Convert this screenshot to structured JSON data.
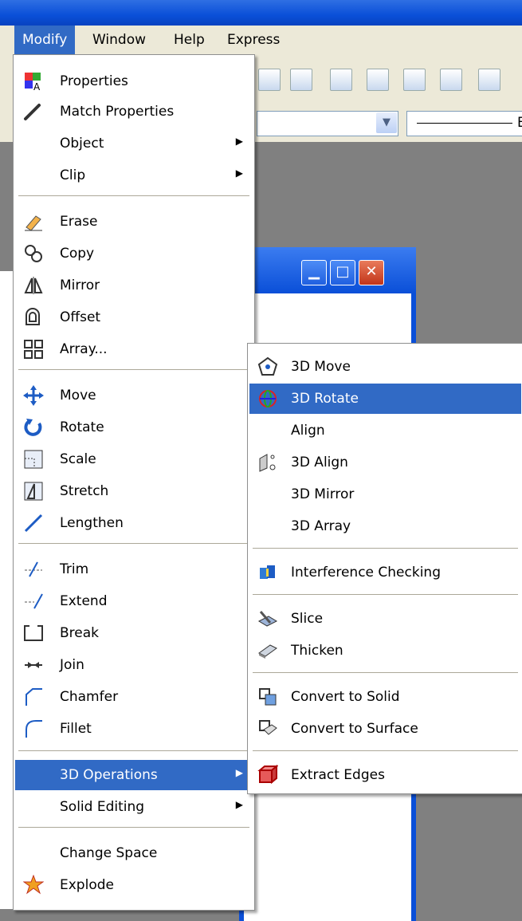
{
  "menubar": {
    "items": [
      "Modify",
      "Window",
      "Help",
      "Express"
    ]
  },
  "modify_menu": {
    "items": [
      {
        "label": "Properties",
        "icon": "properties-icon"
      },
      {
        "label": "Match Properties",
        "icon": "paintbrush-icon"
      },
      {
        "label": "Object",
        "submenu": true
      },
      {
        "label": "Clip",
        "submenu": true
      },
      {
        "label": "Erase",
        "icon": "eraser-icon"
      },
      {
        "label": "Copy",
        "icon": "copy-icon"
      },
      {
        "label": "Mirror",
        "icon": "mirror-icon"
      },
      {
        "label": "Offset",
        "icon": "offset-icon"
      },
      {
        "label": "Array...",
        "icon": "array-icon"
      },
      {
        "label": "Move",
        "icon": "move-icon"
      },
      {
        "label": "Rotate",
        "icon": "rotate-icon"
      },
      {
        "label": "Scale",
        "icon": "scale-icon"
      },
      {
        "label": "Stretch",
        "icon": "stretch-icon"
      },
      {
        "label": "Lengthen",
        "icon": "lengthen-icon"
      },
      {
        "label": "Trim",
        "icon": "trim-icon"
      },
      {
        "label": "Extend",
        "icon": "extend-icon"
      },
      {
        "label": "Break",
        "icon": "break-icon"
      },
      {
        "label": "Join",
        "icon": "join-icon"
      },
      {
        "label": "Chamfer",
        "icon": "chamfer-icon"
      },
      {
        "label": "Fillet",
        "icon": "fillet-icon"
      },
      {
        "label": "3D Operations",
        "submenu": true,
        "selected": true
      },
      {
        "label": "Solid Editing",
        "submenu": true
      },
      {
        "label": "Change Space"
      },
      {
        "label": "Explode",
        "icon": "explode-icon"
      }
    ]
  },
  "ops_menu": {
    "items": [
      {
        "label": "3D Move",
        "icon": "3d-move-icon"
      },
      {
        "label": "3D Rotate",
        "icon": "3d-rotate-icon",
        "selected": true
      },
      {
        "label": "Align"
      },
      {
        "label": "3D Align",
        "icon": "3d-align-icon"
      },
      {
        "label": "3D Mirror"
      },
      {
        "label": "3D Array"
      },
      {
        "label": "Interference Checking",
        "icon": "interference-icon"
      },
      {
        "label": "Slice",
        "icon": "slice-icon"
      },
      {
        "label": "Thicken",
        "icon": "thicken-icon"
      },
      {
        "label": "Convert to Solid",
        "icon": "convert-solid-icon"
      },
      {
        "label": "Convert to Surface",
        "icon": "convert-surface-icon"
      },
      {
        "label": "Extract Edges",
        "icon": "extract-edges-icon"
      }
    ]
  },
  "propbar": {
    "linetype_text": "B"
  },
  "colors": {
    "selection": "#316ac5",
    "menu_bg": "#ffffff",
    "chrome": "#ece9d8",
    "titlebar": "#0a4fd8"
  }
}
